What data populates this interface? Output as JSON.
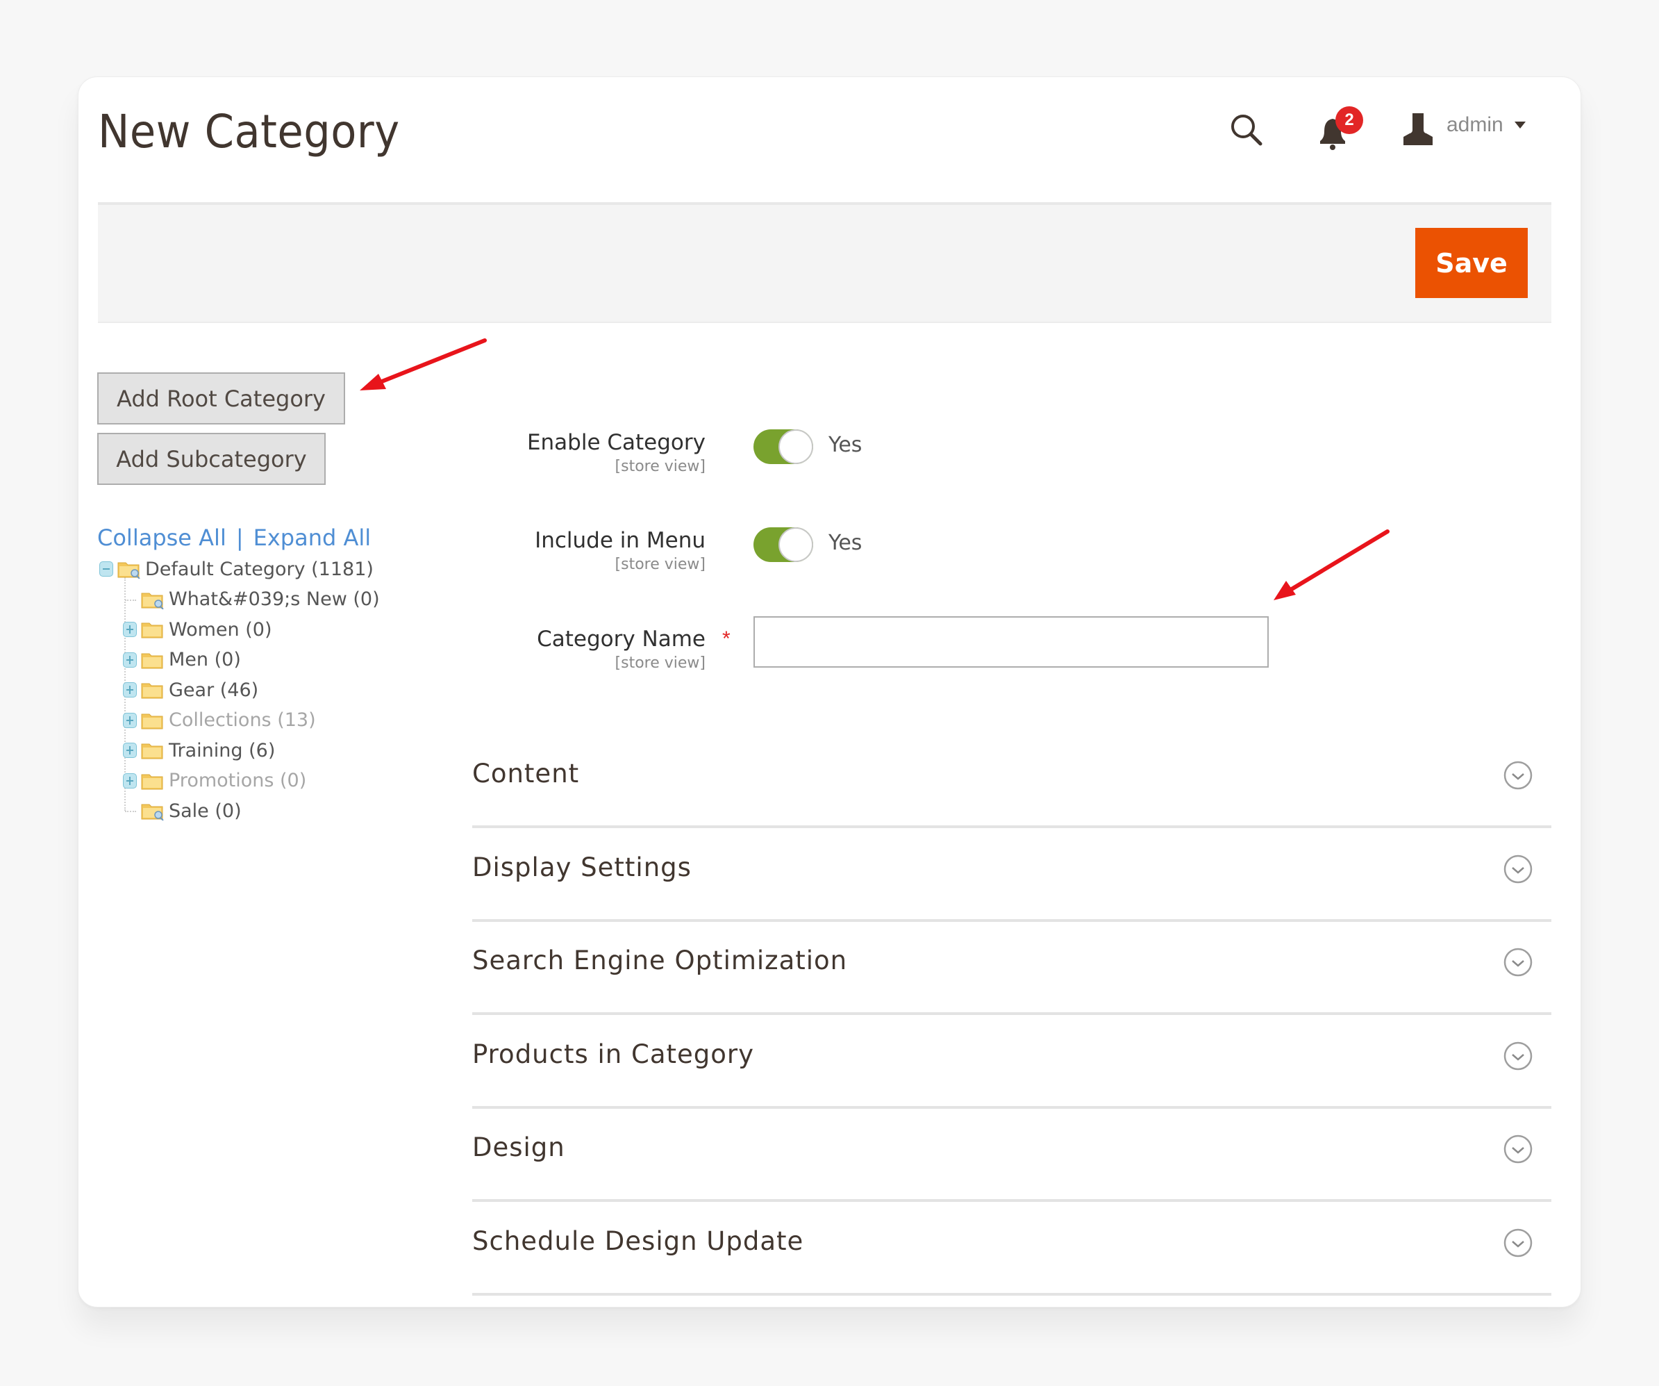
{
  "header": {
    "title": "New Category",
    "notifications_count": "2",
    "user_label": "admin",
    "icons": [
      "search-icon",
      "bell-icon",
      "user-icon",
      "caret-down-icon"
    ]
  },
  "action_bar": {
    "save_label": "Save",
    "accent_color": "#eb5202"
  },
  "sidebar": {
    "add_root_label": "Add Root Category",
    "add_sub_label": "Add Subcategory",
    "collapse_all": "Collapse All",
    "separator": "|",
    "expand_all": "Expand All",
    "tree": [
      {
        "label": "Default Category (1181)",
        "level": 0,
        "toggle": "minus",
        "icon": "folder-search-icon",
        "disabled": false
      },
      {
        "label": "What&#039;s New (0)",
        "level": 1,
        "toggle": "none",
        "icon": "folder-search-icon",
        "disabled": false
      },
      {
        "label": "Women (0)",
        "level": 1,
        "toggle": "plus",
        "icon": "folder-icon",
        "disabled": false
      },
      {
        "label": "Men (0)",
        "level": 1,
        "toggle": "plus",
        "icon": "folder-icon",
        "disabled": false
      },
      {
        "label": "Gear (46)",
        "level": 1,
        "toggle": "plus",
        "icon": "folder-icon",
        "disabled": false
      },
      {
        "label": "Collections (13)",
        "level": 1,
        "toggle": "plus",
        "icon": "folder-icon",
        "disabled": true
      },
      {
        "label": "Training (6)",
        "level": 1,
        "toggle": "plus",
        "icon": "folder-icon",
        "disabled": false
      },
      {
        "label": "Promotions (0)",
        "level": 1,
        "toggle": "plus",
        "icon": "folder-icon",
        "disabled": true
      },
      {
        "label": "Sale (0)",
        "level": 1,
        "toggle": "none",
        "icon": "folder-search-icon",
        "disabled": false
      }
    ]
  },
  "form": {
    "enable_category": {
      "label": "Enable Category",
      "scope": "[store view]",
      "value": "Yes",
      "on": true
    },
    "include_in_menu": {
      "label": "Include in Menu",
      "scope": "[store view]",
      "value": "Yes",
      "on": true
    },
    "category_name": {
      "label": "Category Name",
      "scope": "[store view]",
      "required_mark": "*",
      "value": "",
      "placeholder": ""
    },
    "toggle_color": "#79a22e"
  },
  "sections": [
    {
      "title": "Content"
    },
    {
      "title": "Display Settings"
    },
    {
      "title": "Search Engine Optimization"
    },
    {
      "title": "Products in Category"
    },
    {
      "title": "Design"
    },
    {
      "title": "Schedule Design Update"
    }
  ],
  "annotations": {
    "arrow_color": "#e8141b",
    "arrows": [
      "points-to-add-root-category",
      "points-to-category-name-input"
    ]
  }
}
